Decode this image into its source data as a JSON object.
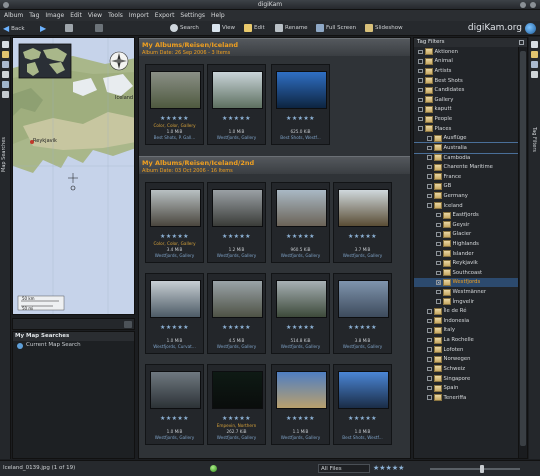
{
  "window": {
    "title": "digiKam"
  },
  "menu": [
    "Album",
    "Tag",
    "Image",
    "Edit",
    "View",
    "Tools",
    "Import",
    "Export",
    "Settings",
    "Help"
  ],
  "toolbar": {
    "back": "Back",
    "search": "Search",
    "view": "View",
    "edit": "Edit",
    "rename": "Rename",
    "fullscreen": "Full Screen",
    "slideshow": "Slideshow",
    "brand": "digiKam.org"
  },
  "left_sidebar": {
    "tab_label": "Map Searches"
  },
  "map": {
    "labels": {
      "iceland": "Iceland",
      "reykjavik": "Reykjavik"
    },
    "scale": {
      "km": "50 km",
      "mi": "50 mi"
    }
  },
  "map_searches": {
    "title": "My Map Searches",
    "current": "Current Map Search"
  },
  "albums": [
    {
      "title": "My Albums/Reisen/Iceland",
      "subtitle": "Album Date: 26 Sep 2006 - 3 Items",
      "items": [
        {
          "l1": "Color, Color, Gallery",
          "l2": "1.0 MiB",
          "l3": "Best Shots, P. Gall...",
          "colors": [
            "#8a8f86",
            "#4f5a3f"
          ]
        },
        {
          "l1": "",
          "l2": "1.0 MiB",
          "l3": "Westfjords, Gallery",
          "colors": [
            "#c9d4d9",
            "#5d7060"
          ]
        },
        {
          "l1": "",
          "l2": "625.0 KiB",
          "l3": "Best Shots, Westf...",
          "colors": [
            "#2f6fc4",
            "#0d2440"
          ]
        }
      ]
    },
    {
      "title": "My Albums/Reisen/Iceland/2nd",
      "subtitle": "Album Date: 03 Oct 2006 - 16 Items",
      "items": [
        {
          "l1": "Color, Color, Gallery",
          "l2": "3.4 MiB",
          "l3": "Westfjords, Gallery",
          "colors": [
            "#b8c0c2",
            "#4a463e"
          ]
        },
        {
          "l1": "",
          "l2": "1.2 MiB",
          "l3": "Westfjords, Gallery",
          "colors": [
            "#9aa0a4",
            "#3a3c38"
          ]
        },
        {
          "l1": "",
          "l2": "960.5 KiB",
          "l3": "Westfjords, Gallery",
          "colors": [
            "#a9b8c4",
            "#6b6357"
          ]
        },
        {
          "l1": "",
          "l2": "3.7 MiB",
          "l3": "Westfjords, Gallery",
          "colors": [
            "#cfd8dc",
            "#5a4d35"
          ]
        },
        {
          "l1": "",
          "l2": "1.0 MiB",
          "l3": "Westfjords, Curvat...",
          "colors": [
            "#c7ced3",
            "#4d5b66"
          ]
        },
        {
          "l1": "",
          "l2": "4.5 MiB",
          "l3": "Westfjords, Gallery",
          "colors": [
            "#9aa3a8",
            "#4e5245"
          ]
        },
        {
          "l1": "",
          "l2": "514.8 KiB",
          "l3": "Westfjords, Gallery",
          "colors": [
            "#a7b0b4",
            "#3d4a3a"
          ]
        },
        {
          "l1": "",
          "l2": "3.8 MiB",
          "l3": "Westfjords, Gallery",
          "colors": [
            "#7f94ad",
            "#3d4b5c"
          ]
        },
        {
          "l1": "",
          "l2": "1.0 MiB",
          "l3": "Westfjords, Gallery",
          "colors": [
            "#6f7880",
            "#2c3236"
          ]
        },
        {
          "l1": "Empevin, Northern",
          "l2": "262.7 KiB",
          "l3": "Westfjords, Gallery",
          "colors": [
            "#0e1a14",
            "#0a0d0c"
          ]
        },
        {
          "l1": "",
          "l2": "1.1 MiB",
          "l3": "Westfjords, Gallery",
          "colors": [
            "#4f7ec2",
            "#b9a06d"
          ]
        },
        {
          "l1": "",
          "l2": "1.0 MiB",
          "l3": "Best Shots, Westf...",
          "colors": [
            "#4b86d6",
            "#1a2c46"
          ]
        }
      ]
    }
  ],
  "tag_filters": {
    "title": "Tag Filters",
    "tags": [
      {
        "label": "Aktionen",
        "indent": 0,
        "state": ""
      },
      {
        "label": "Animal",
        "indent": 0,
        "state": ""
      },
      {
        "label": "Artists",
        "indent": 0,
        "state": ""
      },
      {
        "label": "Best Shots",
        "indent": 0,
        "state": ""
      },
      {
        "label": "Candidates",
        "indent": 0,
        "state": ""
      },
      {
        "label": "Gallery",
        "indent": 0,
        "state": ""
      },
      {
        "label": "kaputt",
        "indent": 0,
        "state": ""
      },
      {
        "label": "People",
        "indent": 0,
        "state": ""
      },
      {
        "label": "Places",
        "indent": 0,
        "state": ""
      },
      {
        "label": "Ausflüge",
        "indent": 1,
        "state": ""
      },
      {
        "label": "Australia",
        "indent": 1,
        "state": "hover"
      },
      {
        "label": "Cambodia",
        "indent": 1,
        "state": ""
      },
      {
        "label": "Charente Maritime",
        "indent": 1,
        "state": ""
      },
      {
        "label": "France",
        "indent": 1,
        "state": ""
      },
      {
        "label": "GB",
        "indent": 1,
        "state": ""
      },
      {
        "label": "Germany",
        "indent": 1,
        "state": ""
      },
      {
        "label": "Iceland",
        "indent": 1,
        "state": ""
      },
      {
        "label": "Eastfjords",
        "indent": 2,
        "state": ""
      },
      {
        "label": "Geysir",
        "indent": 2,
        "state": ""
      },
      {
        "label": "Glacier",
        "indent": 2,
        "state": ""
      },
      {
        "label": "Highlands",
        "indent": 2,
        "state": ""
      },
      {
        "label": "Islander",
        "indent": 2,
        "state": ""
      },
      {
        "label": "Reykjavik",
        "indent": 2,
        "state": ""
      },
      {
        "label": "Southcoast",
        "indent": 2,
        "state": ""
      },
      {
        "label": "Westfjords",
        "indent": 2,
        "state": "selected"
      },
      {
        "label": "Westmänner",
        "indent": 2,
        "state": ""
      },
      {
        "label": "Ímgvelir",
        "indent": 2,
        "state": ""
      },
      {
        "label": "Île de Ré",
        "indent": 1,
        "state": ""
      },
      {
        "label": "Indonesia",
        "indent": 1,
        "state": ""
      },
      {
        "label": "Italy",
        "indent": 1,
        "state": ""
      },
      {
        "label": "La Rochelle",
        "indent": 1,
        "state": ""
      },
      {
        "label": "Lofoten",
        "indent": 1,
        "state": ""
      },
      {
        "label": "Norwegen",
        "indent": 1,
        "state": ""
      },
      {
        "label": "Schweiz",
        "indent": 1,
        "state": ""
      },
      {
        "label": "Singapore",
        "indent": 1,
        "state": ""
      },
      {
        "label": "Spain",
        "indent": 1,
        "state": ""
      },
      {
        "label": "Teneriffa",
        "indent": 1,
        "state": ""
      }
    ]
  },
  "right_sidebar": {
    "tab_label": "Tag Filters"
  },
  "statusbar": {
    "file": "Iceland_0139.jpg (1 of 19)",
    "filter": "All Files",
    "stars": "★★★★★"
  },
  "colors": {
    "album_header_text": "#f0a020",
    "accent_blue": "#8db2d6",
    "selection": "#2c4a6e"
  }
}
